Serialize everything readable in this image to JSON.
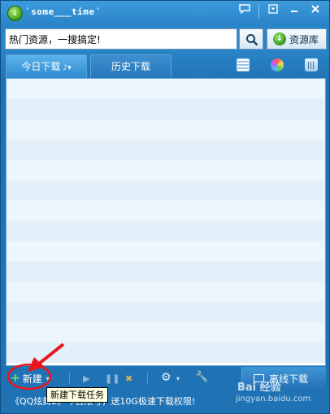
{
  "window": {
    "title": "`some___time´",
    "buttons": [
      {
        "name": "feedback-icon",
        "glyph": "💬"
      },
      {
        "name": "menu-icon",
        "glyph": "▣"
      },
      {
        "name": "minimize-icon",
        "glyph": "—"
      },
      {
        "name": "close-icon",
        "glyph": "✕"
      }
    ]
  },
  "search": {
    "value": "热门资源，一搜搞定!",
    "button_icon": "search-icon",
    "resource_label": "资源库"
  },
  "tabs": [
    {
      "label": "今日下载",
      "arrow": "♪▾"
    },
    {
      "label": "历史下载"
    }
  ],
  "toolbar_icons": [
    "list-icon",
    "skin-icon",
    "recycle-bin-icon"
  ],
  "list": {
    "rows": 14
  },
  "bottom": {
    "new_label": "新建",
    "offline_label": "离线下载",
    "promo": "《QQ炫舞2》今日限号，送10G极速下载权限!",
    "tooltip": "新建下载任务"
  },
  "watermark": {
    "text": "Bai 经验",
    "url": "jingyan.baidu.com"
  },
  "colors": {
    "title_bar": "#3d9bdb",
    "window_bg": "#2a84c8",
    "list_row_odd": "#eef6fd",
    "list_row_even": "#e3eff9",
    "annotation_red": "#e8161b"
  }
}
